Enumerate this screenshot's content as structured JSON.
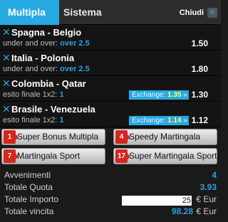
{
  "header": {
    "tab_multipla": "Multipla",
    "tab_sistema": "Sistema",
    "close_label": "Chiudi",
    "close_icon_glyph": "✕"
  },
  "bets": [
    {
      "remove": "✕",
      "title": "Spagna - Belgio",
      "market": "under and over:",
      "selection": "over 2.5",
      "odd": "1.50"
    },
    {
      "remove": "✕",
      "title": "Italia - Polonia",
      "market": "under and over:",
      "selection": "over 2.5",
      "odd": "1.80"
    },
    {
      "remove": "✕",
      "title": "Colombia - Qatar",
      "market": "esito finale 1x2:",
      "selection": "1",
      "exchange_label": "Exchange:",
      "exchange_value": "1.35",
      "exchange_arrow": "»",
      "odd": "1.30"
    },
    {
      "remove": "✕",
      "title": "Brasile - Venezuela",
      "market": "esito finale 1x2:",
      "selection": "1",
      "exchange_label": "Exchange:",
      "exchange_value": "1.14",
      "exchange_arrow": "»",
      "odd": "1.12"
    }
  ],
  "promos": [
    {
      "badge": "1",
      "label": "Super Bonus Multipla"
    },
    {
      "badge": "4",
      "label": "Speedy Martingala"
    },
    {
      "badge": "7",
      "label": "Martingala Sport"
    },
    {
      "badge": "17",
      "label": "Super Martingala Sport"
    }
  ],
  "summary": {
    "avvenimenti_label": "Avvenimenti",
    "avvenimenti_value": "4",
    "quota_label": "Totale Quota",
    "quota_value": "3.93",
    "importo_label": "Totale Importo",
    "importo_value": "25",
    "importo_unit": "€ Eur",
    "vincita_label": "Totale vincita",
    "vincita_value": "98.28",
    "vincita_unit": "€ Eur"
  },
  "colors": {
    "accent": "#27a9e1",
    "badge": "#d7261e",
    "exchange_value": "#ffff66"
  }
}
